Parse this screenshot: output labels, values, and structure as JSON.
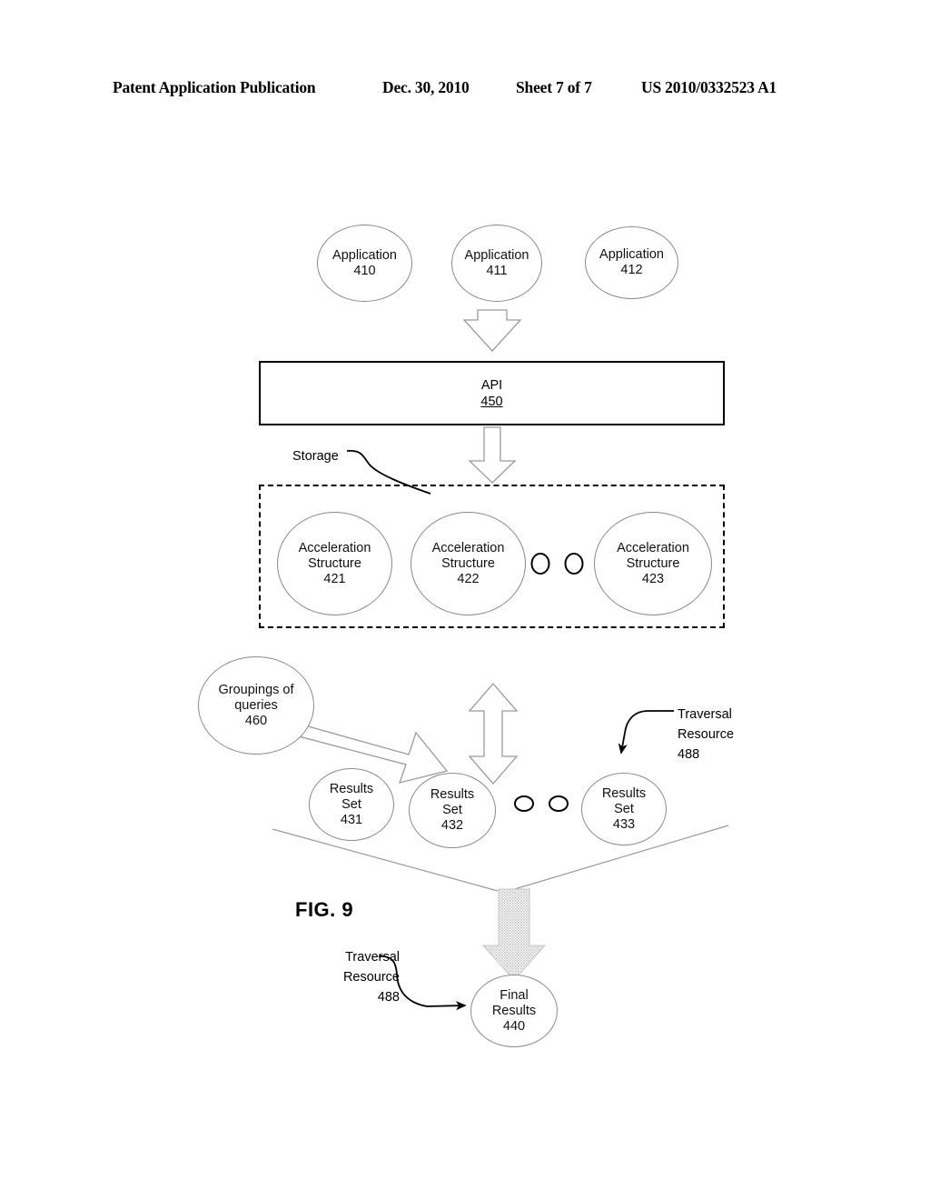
{
  "header": {
    "publication": "Patent Application Publication",
    "date": "Dec. 30, 2010",
    "sheet": "Sheet 7 of 7",
    "number": "US 2010/0332523 A1"
  },
  "figure": {
    "caption": "FIG. 9"
  },
  "applications": [
    {
      "label": "Application",
      "ref": "410"
    },
    {
      "label": "Application",
      "ref": "411"
    },
    {
      "label": "Application",
      "ref": "412"
    }
  ],
  "api": {
    "label": "API",
    "ref": "450"
  },
  "storage": {
    "label": "Storage",
    "structures": [
      {
        "line1": "Acceleration",
        "line2": "Structure",
        "ref": "421"
      },
      {
        "line1": "Acceleration",
        "line2": "Structure",
        "ref": "422"
      },
      {
        "line1": "Acceleration",
        "line2": "Structure",
        "ref": "423"
      }
    ]
  },
  "groupings": {
    "line1": "Groupings of",
    "line2": "queries",
    "ref": "460"
  },
  "results_sets": [
    {
      "line1": "Results",
      "line2": "Set",
      "ref": "431"
    },
    {
      "line1": "Results",
      "line2": "Set",
      "ref": "432"
    },
    {
      "line1": "Results",
      "line2": "Set",
      "ref": "433"
    }
  ],
  "traversal_resource_top": {
    "line1": "Traversal",
    "line2": "Resource",
    "ref": "488"
  },
  "traversal_resource_bottom": {
    "line1": "Traversal",
    "line2": "Resource",
    "ref": "488"
  },
  "final_results": {
    "line1": "Final",
    "line2": "Results",
    "ref": "440"
  },
  "colors": {
    "ink": "#000000",
    "thin_stroke": "#9a9a9a",
    "funnel_fill": "#d9d9d9",
    "page_background": "#ffffff"
  }
}
